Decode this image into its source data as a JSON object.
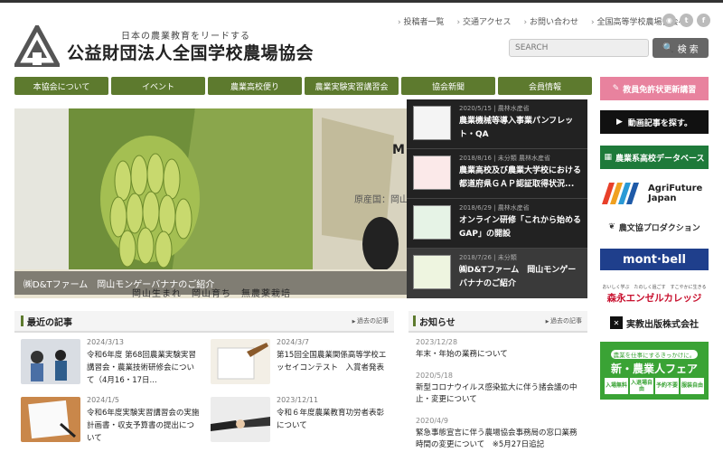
{
  "header": {
    "tagline": "日本の農業教育をリードする",
    "org_name": "公益財団法人全国学校農場協会",
    "links": [
      "投稿者一覧",
      "交通アクセス",
      "お問い合わせ",
      "全国高等学校農場協会へ"
    ],
    "social": [
      "rss-icon",
      "twitter-icon",
      "facebook-icon"
    ],
    "search_placeholder": "SEARCH",
    "search_button": "検 索"
  },
  "nav": [
    "本協会について",
    "イベント",
    "農業高校便り",
    "農業実験実習講習会",
    "協会新聞",
    "会員情報"
  ],
  "hero": {
    "caption": "㈱D&Tファーム　岡山モンゲーバナナのご紹介",
    "overlay_text": "岡山生まれ　岡山育ち　無農薬栽培",
    "overlay_origin": "原産国：岡山",
    "overlay_m": "M"
  },
  "news": [
    {
      "date": "2020/5/15",
      "category": "農林水産省",
      "title": "農業機械等導入事業パンフレット・QA"
    },
    {
      "date": "2018/8/16",
      "category": "未分類 農林水産省",
      "title": "農業高校及び農業大学校における都道府県ＧＡＰ認証取得状況..."
    },
    {
      "date": "2018/6/29",
      "category": "農林水産省",
      "title": "オンライン研修「これから始めるGAP」の開設"
    },
    {
      "date": "2018/7/26",
      "category": "未分類",
      "title": "㈱D&Tファーム　岡山モンゲーバナナのご紹介"
    }
  ],
  "banners": {
    "kyoin": "教員免許状更新講習",
    "douga": "動画記事を探す。",
    "database": "農業系高校データベース",
    "agrifuture1": "AgriFuture",
    "agrifuture2": "Japan",
    "nobunkyo": "農文協プロダクション",
    "montbell": "mont·bell",
    "morishin_sub": "おいしく学ぶ　たのしく過ごす　すこやかに生きる",
    "morishin": "森永エンゼルカレッジ",
    "jikkyo": "実教出版株式会社",
    "fair_top": "農業を仕事にするきっかけに。",
    "fair_title": "新・農業人フェア",
    "fair_tags": [
      "入場無料",
      "入退場自由",
      "予約不要",
      "服装自由"
    ]
  },
  "recent": {
    "title": "最近の記事",
    "more": "過去の記事",
    "posts": [
      {
        "date": "2024/3/13",
        "title": "令和6年度 第68回農業実験実習講習会・農業技術研修会について（4月16・17日..."
      },
      {
        "date": "2024/3/7",
        "title": "第15回全国農業関係高等学校エッセイコンテスト　入賞者発表"
      },
      {
        "date": "2024/1/5",
        "title": "令和6年度実験実習講習会の実施計画書・収支予算書の提出について"
      },
      {
        "date": "2023/12/11",
        "title": "令和６年度農業教育功労者表彰について"
      }
    ]
  },
  "notices": {
    "title": "お知らせ",
    "more": "過去の記事",
    "items": [
      {
        "date": "2023/12/28",
        "title": "年末・年始の業務について"
      },
      {
        "date": "2020/5/18",
        "title": "新型コロナウイルス感染拡大に伴う諸会議の中止・変更について"
      },
      {
        "date": "2020/4/9",
        "title": "緊急事態宣言に伴う農場協会事務局の窓口業務時間の変更について　※5月27日追記"
      }
    ]
  }
}
